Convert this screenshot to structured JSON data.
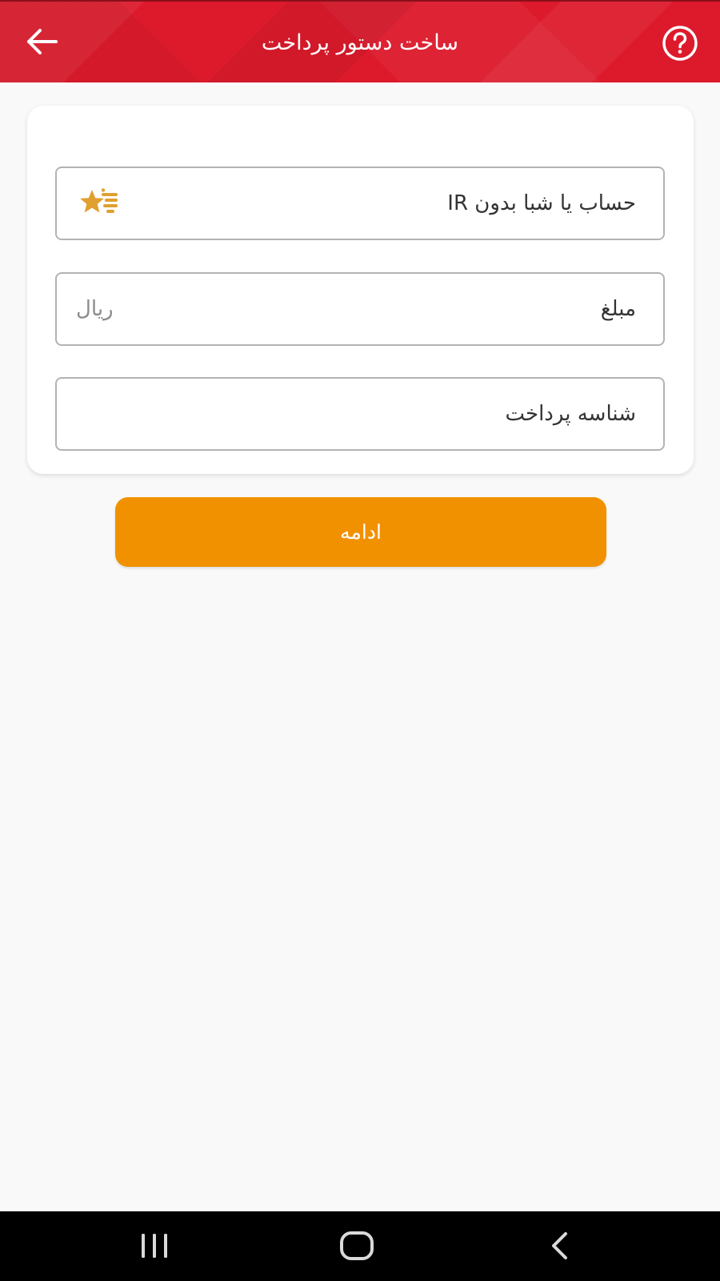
{
  "header": {
    "title": "ساخت دستور پرداخت",
    "back_icon": "arrow-left-icon",
    "help_icon": "question-circle-icon"
  },
  "form": {
    "account": {
      "label": "حساب یا شبا بدون IR",
      "icon": "favorite-star-list-icon"
    },
    "amount": {
      "label": "مبلغ",
      "unit": "ریال"
    },
    "payment_id": {
      "label": "شناسه پرداخت"
    }
  },
  "actions": {
    "continue_label": "ادامه"
  },
  "system_nav": {
    "recents_icon": "recents-icon",
    "home_icon": "home-icon",
    "back_icon": "chevron-left-icon"
  },
  "colors": {
    "header_red": "#dc1a2c",
    "primary_orange": "#f29100",
    "star_gold": "#e0a030"
  }
}
